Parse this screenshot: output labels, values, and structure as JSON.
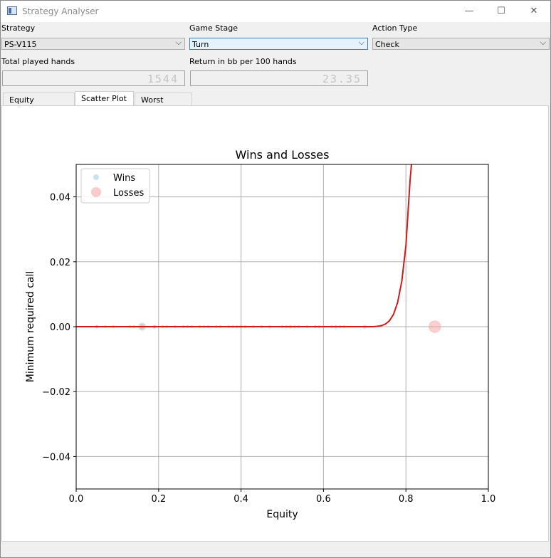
{
  "window": {
    "title": "Strategy Analyser",
    "controls": [
      "—",
      "☐",
      "✕"
    ]
  },
  "controls": {
    "strategy": {
      "label": "Strategy",
      "value": "PS-V115"
    },
    "game_stage": {
      "label": "Game Stage",
      "value": "Turn"
    },
    "action_type": {
      "label": "Action Type",
      "value": "Check"
    },
    "total_hands": {
      "label": "Total played hands",
      "value": "1544"
    },
    "return_bb": {
      "label": "Return in bb per 100 hands",
      "value": "23.35"
    }
  },
  "tabs": [
    {
      "label": "Equity Histogram",
      "selected": false
    },
    {
      "label": "Scatter Plot",
      "selected": true
    },
    {
      "label": "Worst Hands",
      "selected": false
    }
  ],
  "chart_data": {
    "type": "scatter",
    "title": "Wins and Losses",
    "xlabel": "Equity",
    "ylabel": "Minimum required call",
    "xlim": [
      0.0,
      1.0
    ],
    "ylim": [
      -0.05,
      0.05
    ],
    "xticks": [
      "0.0",
      "0.2",
      "0.4",
      "0.6",
      "0.8",
      "1.0"
    ],
    "yticks": [
      "−0.04",
      "−0.02",
      "0.00",
      "0.02",
      "0.04"
    ],
    "xtick_values": [
      0.0,
      0.2,
      0.4,
      0.6,
      0.8,
      1.0
    ],
    "ytick_values": [
      -0.04,
      -0.02,
      0.0,
      0.02,
      0.04
    ],
    "grid": true,
    "legend_position": "top-left",
    "series": [
      {
        "name": "Wins",
        "color": "#a6cee3",
        "points": [
          [
            0.05,
            0,
            1
          ],
          [
            0.07,
            0,
            1
          ],
          [
            0.13,
            0,
            1
          ],
          [
            0.16,
            0,
            2.5
          ],
          [
            0.19,
            0,
            1
          ],
          [
            0.22,
            0,
            1
          ],
          [
            0.27,
            0,
            1
          ],
          [
            0.31,
            0,
            1
          ],
          [
            0.35,
            0,
            1
          ],
          [
            0.38,
            0,
            1
          ],
          [
            0.4,
            0,
            1.3
          ],
          [
            0.45,
            0,
            1
          ],
          [
            0.51,
            0,
            1
          ],
          [
            0.53,
            0,
            1
          ],
          [
            0.56,
            0,
            1
          ],
          [
            0.59,
            0,
            1
          ],
          [
            0.63,
            0,
            1.2
          ],
          [
            0.65,
            0,
            1
          ]
        ]
      },
      {
        "name": "Losses",
        "color": "#f4a6a6",
        "points": [
          [
            0.05,
            0,
            1
          ],
          [
            0.09,
            0,
            1
          ],
          [
            0.14,
            0,
            1
          ],
          [
            0.16,
            0,
            1.5
          ],
          [
            0.19,
            0,
            1.2
          ],
          [
            0.21,
            0,
            1
          ],
          [
            0.24,
            0,
            1
          ],
          [
            0.26,
            0,
            1
          ],
          [
            0.28,
            0,
            1
          ],
          [
            0.3,
            0,
            1
          ],
          [
            0.32,
            0,
            1
          ],
          [
            0.34,
            0,
            1
          ],
          [
            0.37,
            0,
            1
          ],
          [
            0.39,
            0,
            1
          ],
          [
            0.41,
            0,
            1
          ],
          [
            0.43,
            0,
            1
          ],
          [
            0.47,
            0,
            1
          ],
          [
            0.5,
            0,
            1
          ],
          [
            0.52,
            0,
            1.2
          ],
          [
            0.54,
            0,
            1
          ],
          [
            0.58,
            0,
            1
          ],
          [
            0.6,
            0,
            1
          ],
          [
            0.62,
            0,
            1
          ],
          [
            0.64,
            0,
            1
          ],
          [
            0.7,
            0,
            1.2
          ],
          [
            0.87,
            0,
            4
          ]
        ]
      }
    ],
    "curve": {
      "color": "#d11a1a",
      "points": [
        [
          0.0,
          0
        ],
        [
          0.7,
          0
        ],
        [
          0.72,
          0
        ],
        [
          0.73,
          0.0001
        ],
        [
          0.74,
          0.0003
        ],
        [
          0.75,
          0.0008
        ],
        [
          0.76,
          0.0018
        ],
        [
          0.77,
          0.0038
        ],
        [
          0.78,
          0.0075
        ],
        [
          0.79,
          0.014
        ],
        [
          0.8,
          0.025
        ],
        [
          0.81,
          0.045
        ],
        [
          0.8135,
          0.05
        ]
      ]
    }
  }
}
